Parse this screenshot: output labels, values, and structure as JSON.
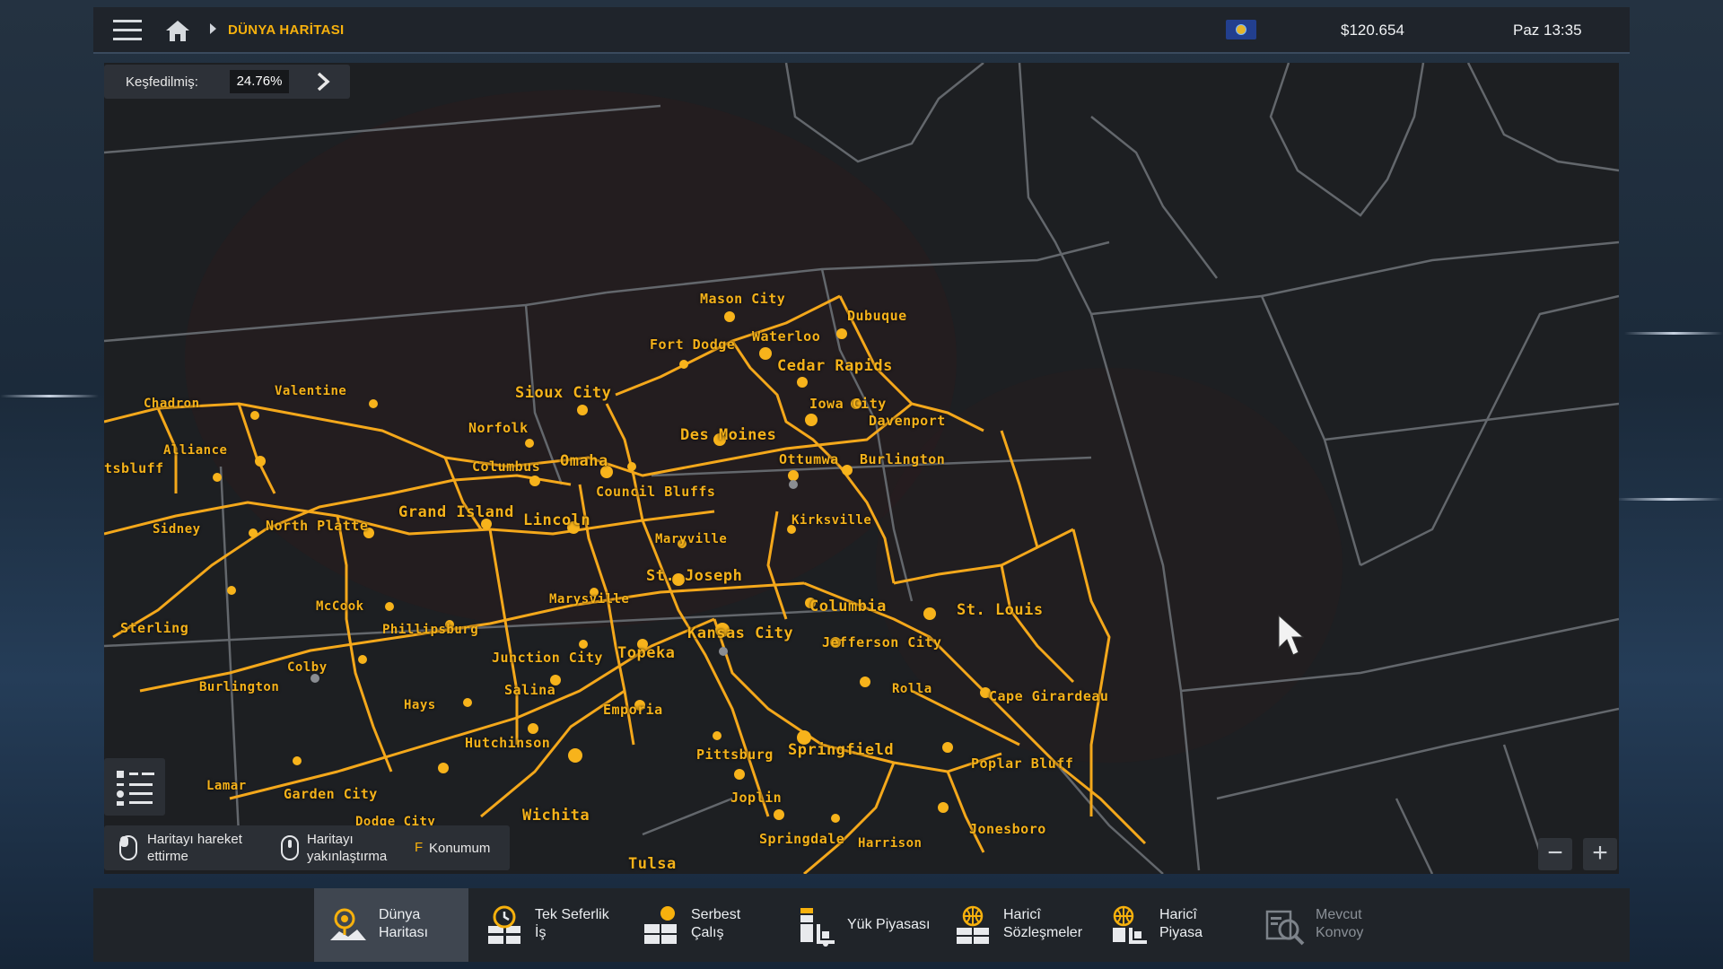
{
  "topbar": {
    "breadcrumb": "DÜNYA HARİTASI",
    "money": "$120.654",
    "clock": "Paz 13:35",
    "icons": [
      "menu-icon",
      "home-icon",
      "state-flag-icon"
    ]
  },
  "explored": {
    "label": "Keşfedilmiş:",
    "value": "24.76%"
  },
  "cities": [
    "Mason City",
    "Dubuque",
    "Waterloo",
    "Fort Dodge",
    "Cedar Rapids",
    "Sioux City",
    "Iowa City",
    "Davenport",
    "Valentine",
    "Chadron",
    "Norfolk",
    "Des Moines",
    "Alliance",
    "Ottumwa",
    "Burlington",
    "Columbus",
    "Omaha",
    "tsbluff",
    "Council Bluffs",
    "Grand Island",
    "Lincoln",
    "Sidney",
    "North Platte",
    "Kirksville",
    "Maryville",
    "St. Joseph",
    "McCook",
    "Marysville",
    "Columbia",
    "St. Louis",
    "Sterling",
    "Phillipsburg",
    "Kansas City",
    "Jefferson City",
    "Junction City",
    "Topeka",
    "Colby",
    "Burlington",
    "Salina",
    "Rolla",
    "Cape Girardeau",
    "Hays",
    "Emporia",
    "Hutchinson",
    "Pittsburg",
    "Springfield",
    "Poplar Bluff",
    "Lamar",
    "Garden City",
    "Joplin",
    "Wichita",
    "Dodge City",
    "Jonesboro",
    "Springdale",
    "Harrison",
    "Tulsa"
  ],
  "hints": {
    "move": "Haritayı hareket ettirme",
    "move_line1": "Haritayı hareket",
    "move_line2": "ettirme",
    "zoom_line1": "Haritayı",
    "zoom_line2": "yakınlaştırma",
    "position_key": "F",
    "position_label": "Konumum"
  },
  "zoom": {
    "out": "−",
    "in": "+"
  },
  "bottom_tabs": [
    {
      "line1": "Dünya",
      "line2": "Haritası",
      "icon": "world-map-icon",
      "active": true
    },
    {
      "line1": "Tek Seferlik",
      "line2": "İş",
      "icon": "quick-job-icon"
    },
    {
      "line1": "Serbest",
      "line2": "Çalış",
      "icon": "freight-market-icon"
    },
    {
      "line1": "Yük Piyasası",
      "line2": "",
      "icon": "cargo-market-icon"
    },
    {
      "line1": "Haricî",
      "line2": "Sözleşmeler",
      "icon": "external-contracts-icon"
    },
    {
      "line1": "Haricî",
      "line2": "Piyasa",
      "icon": "external-market-icon"
    },
    {
      "line1": "Mevcut",
      "line2": "Konvoy",
      "icon": "convoy-icon",
      "disabled": true
    }
  ]
}
